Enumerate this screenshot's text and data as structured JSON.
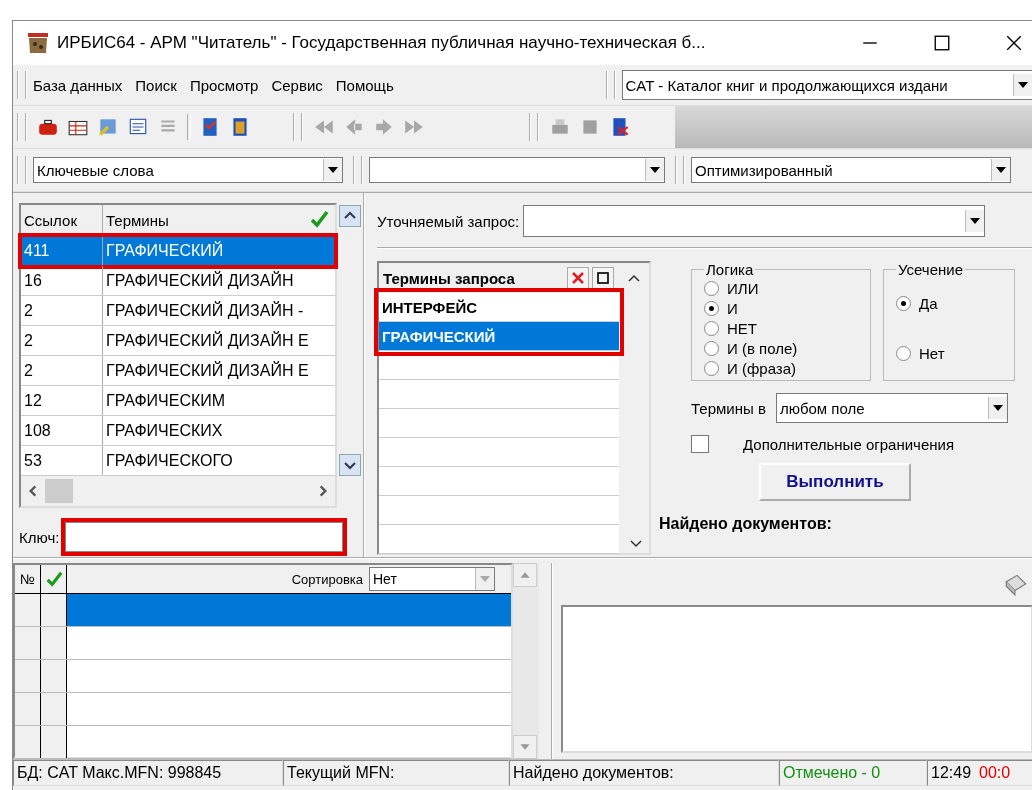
{
  "window": {
    "title": "ИРБИС64 - АРМ \"Читатель\" - Государственная публичная научно-техническая б..."
  },
  "menu": [
    "База данных",
    "Поиск",
    "Просмотр",
    "Сервис",
    "Помощь"
  ],
  "database": {
    "value": "CAT - Каталог книг и продолжающихся издани"
  },
  "search_bar": {
    "search_type": "Ключевые слова",
    "mode": "Оптимизированный"
  },
  "terms_table": {
    "columns": [
      "Ссылок",
      "Термины"
    ],
    "rows": [
      {
        "count": "411",
        "term": "ГРАФИЧЕСКИЙ",
        "selected": true,
        "highlighted": true
      },
      {
        "count": "16",
        "term": "ГРАФИЧЕСКИЙ ДИЗАЙН",
        "selected": false,
        "highlighted": false
      },
      {
        "count": "2",
        "term": "ГРАФИЧЕСКИЙ ДИЗАЙН -",
        "selected": false,
        "highlighted": false
      },
      {
        "count": "2",
        "term": "ГРАФИЧЕСКИЙ ДИЗАЙН Е",
        "selected": false,
        "highlighted": false
      },
      {
        "count": "2",
        "term": "ГРАФИЧЕСКИЙ ДИЗАЙН Е",
        "selected": false,
        "highlighted": false
      },
      {
        "count": "12",
        "term": "ГРАФИЧЕСКИМ",
        "selected": false,
        "highlighted": false
      },
      {
        "count": "108",
        "term": "ГРАФИЧЕСКИХ",
        "selected": false,
        "highlighted": false
      },
      {
        "count": "53",
        "term": "ГРАФИЧЕСКОГО",
        "selected": false,
        "highlighted": false
      }
    ]
  },
  "key_field": {
    "label": "Ключ:",
    "highlighted": true
  },
  "query": {
    "label": "Уточняемый запрос:",
    "terms_list": {
      "title": "Термины запроса",
      "highlighted": true,
      "items": [
        {
          "text": "ИНТЕРФЕЙС",
          "selected": false
        },
        {
          "text": "ГРАФИЧЕСКИЙ",
          "selected": true
        }
      ]
    },
    "logic": {
      "title": "Логика",
      "options": [
        {
          "label": "ИЛИ",
          "selected": false
        },
        {
          "label": "И",
          "selected": true
        },
        {
          "label": "НЕТ",
          "selected": false
        },
        {
          "label": "И (в поле)",
          "selected": false
        },
        {
          "label": "И (фраза)",
          "selected": false
        }
      ]
    },
    "truncation": {
      "title": "Усечение",
      "options": [
        {
          "label": "Да",
          "selected": true
        },
        {
          "label": "Нет",
          "selected": false
        }
      ]
    },
    "terms_in": {
      "label": "Термины в",
      "value": "любом поле"
    },
    "extra_restrictions": {
      "label": "Дополнительные ограничения",
      "checked": false
    },
    "run_button": "Выполнить",
    "found_label": "Найдено документов:"
  },
  "results": {
    "column": "№",
    "sort": {
      "label": "Сортировка",
      "value": "Нет"
    },
    "rows": [
      {
        "selected": true
      },
      {
        "selected": false
      },
      {
        "selected": false
      },
      {
        "selected": false
      },
      {
        "selected": false
      }
    ]
  },
  "status_bar": [
    {
      "kind": "text",
      "text": "БД: CAT Макс.MFN: 998845"
    },
    {
      "kind": "text",
      "text": "Текущий MFN:"
    },
    {
      "kind": "text",
      "text": "Найдено документов:"
    },
    {
      "kind": "marked",
      "text": "Отмечено - 0"
    },
    {
      "kind": "clock",
      "text": "12:49",
      "timer": "00:0"
    }
  ]
}
